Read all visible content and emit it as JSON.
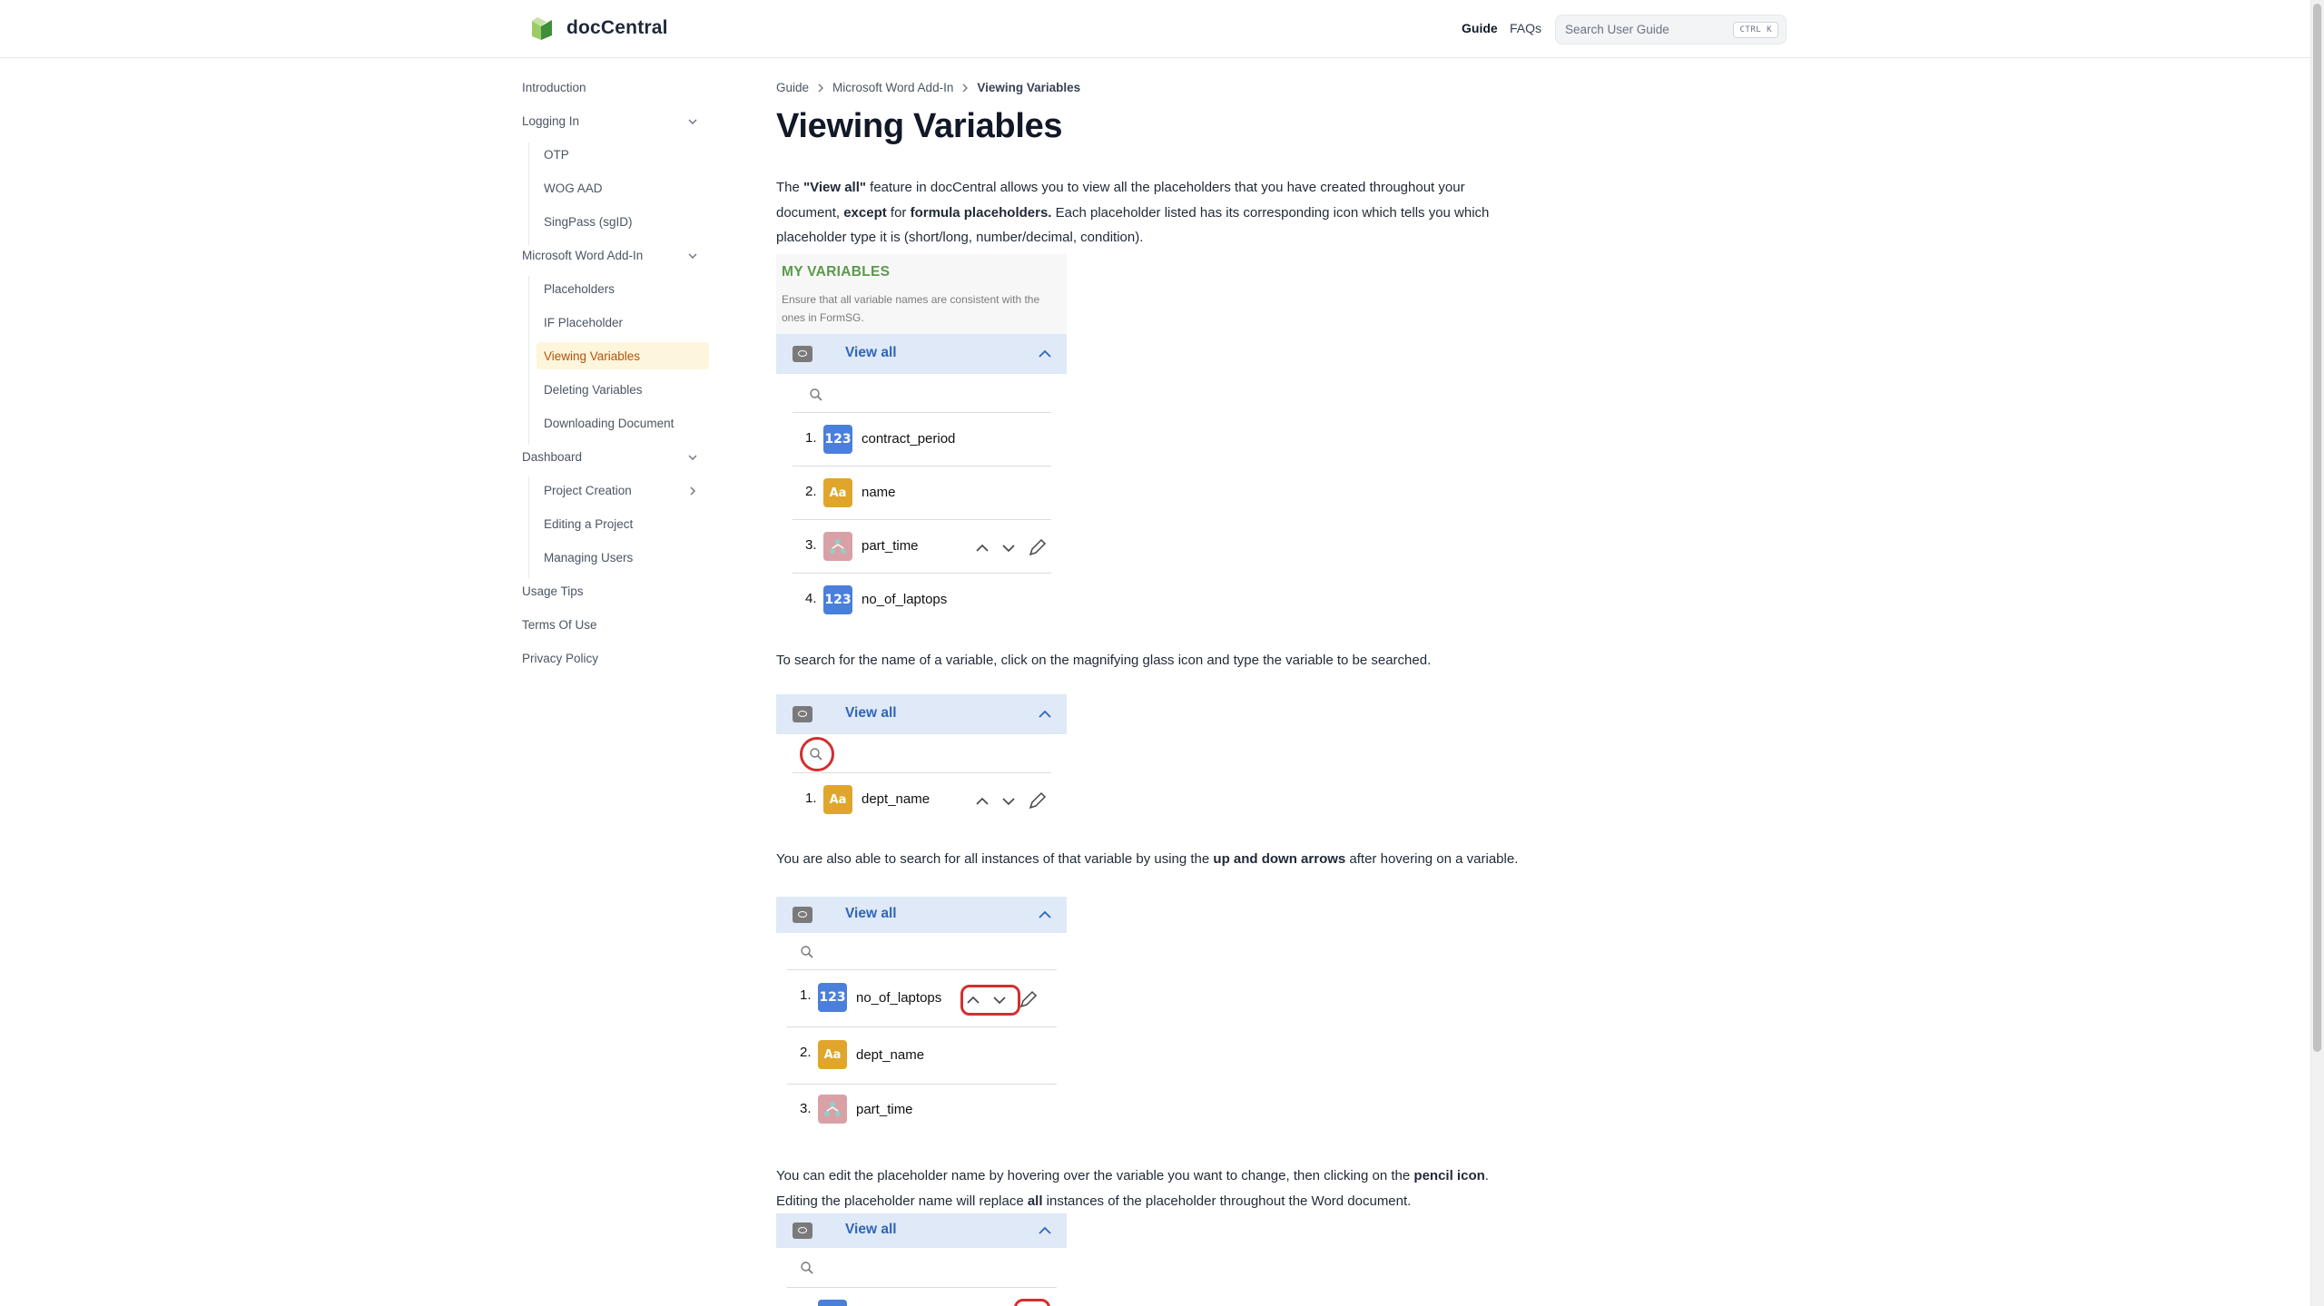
{
  "app": {
    "name": "docCentral",
    "nav": {
      "guide": "Guide",
      "faqs": "FAQs"
    },
    "search": {
      "placeholder": "Search User Guide",
      "shortcut": "CTRL K"
    }
  },
  "sidebar": {
    "items": [
      {
        "label": "Introduction"
      },
      {
        "label": "Logging In"
      },
      {
        "label": "OTP"
      },
      {
        "label": "WOG AAD"
      },
      {
        "label": "SingPass (sgID)"
      },
      {
        "label": "Microsoft Word Add-In"
      },
      {
        "label": "Placeholders"
      },
      {
        "label": "IF Placeholder"
      },
      {
        "label": "Viewing Variables"
      },
      {
        "label": "Deleting Variables"
      },
      {
        "label": "Downloading Document"
      },
      {
        "label": "Dashboard"
      },
      {
        "label": "Project Creation"
      },
      {
        "label": "Editing a Project"
      },
      {
        "label": "Managing Users"
      },
      {
        "label": "Usage Tips"
      },
      {
        "label": "Terms Of Use"
      },
      {
        "label": "Privacy Policy"
      }
    ],
    "active": "Viewing Variables"
  },
  "breadcrumb": [
    "Guide",
    "Microsoft Word Add-In",
    "Viewing Variables"
  ],
  "page": {
    "title": "Viewing Variables",
    "p1": {
      "a": "The ",
      "b": "\"View all\"",
      "c": " feature in docCentral allows you to view all the placeholders that you have created throughout your document, ",
      "d": "except",
      "e": " for ",
      "f": "formula placeholders.",
      "g": " Each placeholder listed has its corresponding icon which tells you which placeholder type it is (short/long, number/decimal, condition)."
    },
    "p2": "To search for the name of a variable, click on the magnifying glass icon and type the variable to be searched.",
    "p3": {
      "a": "You are also able to search for all instances of that variable by using the ",
      "b": "up and down arrows",
      "c": " after hovering on a variable."
    },
    "p4": {
      "a": "You can edit the placeholder name by hovering over the variable you want to change, then clicking on the ",
      "b": "pencil icon",
      "c": ". Editing the placeholder name will replace ",
      "d": "all",
      "e": " instances of the placeholder throughout the Word document."
    }
  },
  "screens": {
    "my_variables_title": "MY VARIABLES",
    "my_variables_sub": "Ensure that all variable names are consistent with the ones in FormSG.",
    "view_all": "View all",
    "badge_number": "123",
    "badge_text": "Aa",
    "list1": [
      {
        "n": "1.",
        "type": "number",
        "name": "contract_period"
      },
      {
        "n": "2.",
        "type": "text",
        "name": "name"
      },
      {
        "n": "3.",
        "type": "condition",
        "name": "part_time"
      },
      {
        "n": "4.",
        "type": "number",
        "name": "no_of_laptops"
      }
    ],
    "list2": [
      {
        "n": "1.",
        "type": "text",
        "name": "dept_name"
      }
    ],
    "list3": [
      {
        "n": "1.",
        "type": "number",
        "name": "no_of_laptops"
      },
      {
        "n": "2.",
        "type": "text",
        "name": "dept_name"
      },
      {
        "n": "3.",
        "type": "condition",
        "name": "part_time"
      }
    ]
  },
  "colors": {
    "brand_green": "#5a9a4a",
    "active_bg": "#fdf5dc",
    "active_text": "#b45309",
    "view_all_blue": "#2f65b8",
    "highlight_red": "#d32f2f"
  }
}
